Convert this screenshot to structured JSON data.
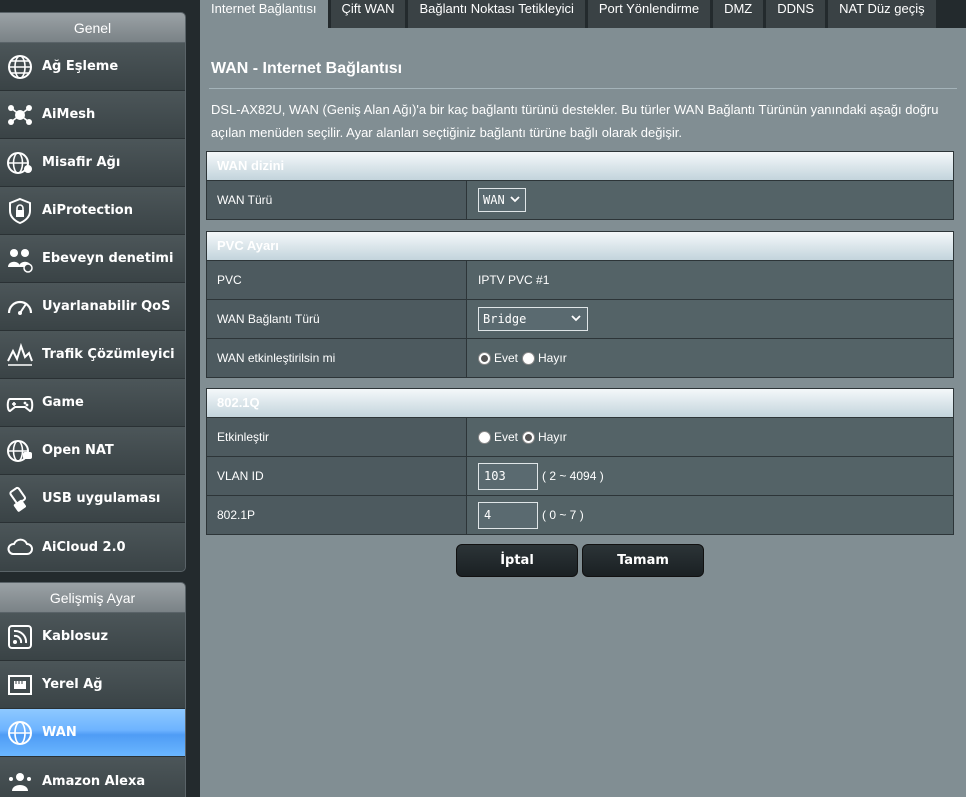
{
  "sidebar": {
    "general_header": "Genel",
    "general_items": [
      {
        "label": "Ağ Eşleme",
        "icon": "globe-icon"
      },
      {
        "label": "AiMesh",
        "icon": "mesh-icon"
      },
      {
        "label": "Misafir Ağı",
        "icon": "guest-network-icon"
      },
      {
        "label": "AiProtection",
        "icon": "lock-shield-icon"
      },
      {
        "label": "Ebeveyn denetimi",
        "icon": "parental-control-icon"
      },
      {
        "label": "Uyarlanabilir QoS",
        "icon": "gauge-icon"
      },
      {
        "label": "Trafik Çözümleyici",
        "icon": "traffic-analyzer-icon"
      },
      {
        "label": "Game",
        "icon": "gamepad-icon"
      },
      {
        "label": "Open NAT",
        "icon": "open-nat-icon"
      },
      {
        "label": "USB uygulaması",
        "icon": "usb-icon"
      },
      {
        "label": "AiCloud 2.0",
        "icon": "cloud-icon"
      }
    ],
    "advanced_header": "Gelişmiş Ayar",
    "advanced_items": [
      {
        "label": "Kablosuz",
        "icon": "wireless-icon"
      },
      {
        "label": "Yerel Ağ",
        "icon": "lan-icon"
      },
      {
        "label": "WAN",
        "icon": "wan-globe-icon",
        "active": true
      },
      {
        "label": "Amazon Alexa",
        "icon": "alexa-icon"
      }
    ]
  },
  "tabs": [
    {
      "label": "Internet Bağlantısı",
      "active": true
    },
    {
      "label": "Çift WAN"
    },
    {
      "label": "Bağlantı Noktası Tetikleyici"
    },
    {
      "label": "Port Yönlendirme"
    },
    {
      "label": "DMZ"
    },
    {
      "label": "DDNS"
    },
    {
      "label": "NAT Düz geçiş"
    }
  ],
  "page": {
    "title": "WAN - Internet Bağlantısı",
    "description": "DSL-AX82U, WAN (Geniş Alan Ağı)'a bir kaç bağlantı türünü destekler. Bu türler WAN Bağlantı Türünün yanındaki aşağı doğru açılan menüden seçilir. Ayar alanları seçtiğiniz bağlantı türüne bağlı olarak değişir."
  },
  "wan_index": {
    "header": "WAN dizini",
    "wan_type_label": "WAN Türü",
    "wan_type_value": "WAN"
  },
  "pvc": {
    "header": "PVC Ayarı",
    "pvc_label": "PVC",
    "pvc_value": "IPTV PVC #1",
    "conn_type_label": "WAN Bağlantı Türü",
    "conn_type_value": "Bridge",
    "enable_wan_label": "WAN etkinleştirilsin mi",
    "yes": "Evet",
    "no": "Hayır",
    "enable_wan_selected": "yes"
  },
  "dot1q": {
    "header": "802.1Q",
    "enable_label": "Etkinleştir",
    "yes": "Evet",
    "no": "Hayır",
    "enable_selected": "no",
    "vlan_label": "VLAN ID",
    "vlan_value": "103",
    "vlan_hint": "( 2 ~ 4094 )",
    "prio_label": "802.1P",
    "prio_value": "4",
    "prio_hint": "( 0 ~ 7 )"
  },
  "buttons": {
    "cancel": "İptal",
    "ok": "Tamam"
  }
}
